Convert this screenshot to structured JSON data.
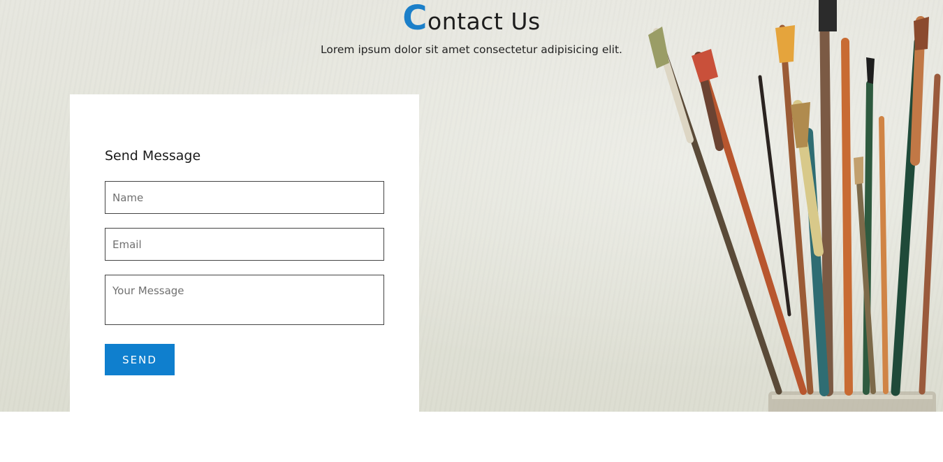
{
  "header": {
    "title_initial": "C",
    "title_rest": "ontact Us",
    "subtitle": "Lorem ipsum dolor sit amet consectetur adipisicing elit."
  },
  "form": {
    "title": "Send Message",
    "name_placeholder": "Name",
    "email_placeholder": "Email",
    "message_placeholder": "Your Message",
    "send_label": "SEND"
  },
  "colors": {
    "accent": "#0f7fce",
    "title_initial": "#1b7fc9"
  },
  "images": {
    "hero_background": "paint-brushes-in-jar"
  }
}
